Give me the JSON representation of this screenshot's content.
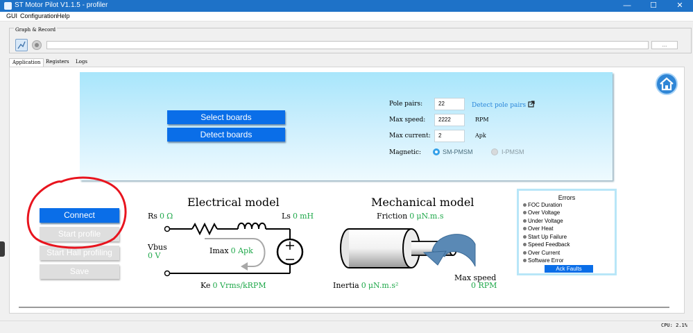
{
  "window": {
    "title": "ST Motor Pilot V1.1.5 - profiler",
    "controls": [
      "—",
      "☐",
      "✕"
    ]
  },
  "menu": [
    "GUI",
    "Configuration",
    "Help"
  ],
  "graph_record": {
    "legend": "Graph & Record",
    "browse_label": "..."
  },
  "tabs": [
    "Application",
    "Registers",
    "Logs"
  ],
  "config": {
    "select_boards": "Select boards",
    "detect_boards": "Detect boards",
    "pole_pairs_label": "Pole pairs:",
    "pole_pairs_value": "22",
    "detect_pole_pairs": "Detect pole pairs",
    "max_speed_label": "Max speed:",
    "max_speed_value": "2222",
    "max_speed_unit": "RPM",
    "max_current_label": "Max current:",
    "max_current_value": "2",
    "max_current_unit": "Apk",
    "magnetic_label": "Magnetic:",
    "magnetic_options": [
      "SM-PMSM",
      "I-PMSM"
    ],
    "magnetic_selected": "SM-PMSM"
  },
  "actions": {
    "connect": "Connect",
    "start_profile": "Start profile",
    "start_hall_profiling": "Start Hall profiling",
    "save": "Save"
  },
  "electrical": {
    "title": "Electrical model",
    "rs_label": "Rs",
    "rs_value": "0",
    "rs_unit": "Ω",
    "ls_label": "Ls",
    "ls_value": "0",
    "ls_unit": "mH",
    "vbus_label": "Vbus",
    "vbus_value": "0 V",
    "imax_label": "Imax",
    "imax_value": "0 Apk",
    "ke_label": "Ke",
    "ke_value": "0 Vrms/kRPM"
  },
  "mechanical": {
    "title": "Mechanical model",
    "friction_label": "Friction",
    "friction_value": "0",
    "friction_unit": "μN.m.s",
    "inertia_label": "Inertia",
    "inertia_value": "0",
    "inertia_unit": "μN.m.s²",
    "max_speed_label": "Max speed",
    "max_speed_value": "0 RPM"
  },
  "errors": {
    "title": "Errors",
    "items": [
      "FOC Duration",
      "Over Voltage",
      "Under Voltage",
      "Over Heat",
      "Start Up Failure",
      "Speed Feedback",
      "Over Current",
      "Software Error"
    ],
    "ack_label": "Ack Faults"
  },
  "status": {
    "cpu": "CPU: 2.1%"
  },
  "colors": {
    "accent": "#0a6ee8",
    "value_green": "#1fa84a",
    "annotation_red": "#e8141e"
  }
}
